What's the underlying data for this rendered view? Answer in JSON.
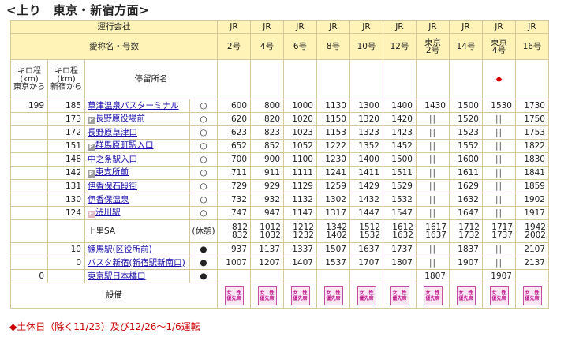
{
  "title": "<上り　東京・新宿方面>",
  "header": {
    "operator_label": "運行会社",
    "name_label": "愛称名・号数",
    "km_tokyo": [
      "キロ程",
      "(km)",
      "東京から"
    ],
    "km_shinjuku": [
      "キロ程",
      "(km)",
      "新宿から"
    ],
    "stop_label": "停留所名",
    "operators": [
      "JR",
      "JR",
      "JR",
      "JR",
      "JR",
      "JR",
      "JR",
      "JR",
      "JR",
      "JR"
    ],
    "names": [
      [
        "2号"
      ],
      [
        "4号"
      ],
      [
        "6号"
      ],
      [
        "8号"
      ],
      [
        "10号"
      ],
      [
        "12号"
      ],
      [
        "東京",
        "2号"
      ],
      [
        "14号"
      ],
      [
        "東京",
        "4号"
      ],
      [
        "16号"
      ]
    ],
    "diamond_col": 8,
    "diamond_text": "◆"
  },
  "rows": [
    {
      "kt": "199",
      "ks": "185",
      "name": "草津温泉バスターミナル",
      "icon": "",
      "mark": "○",
      "times": [
        "600",
        "800",
        "1000",
        "1130",
        "1300",
        "1400",
        "1430",
        "1500",
        "1530",
        "1730"
      ]
    },
    {
      "kt": "",
      "ks": "173",
      "name": "長野原役場前",
      "icon": "P",
      "mark": "○",
      "times": [
        "620",
        "820",
        "1020",
        "1150",
        "1320",
        "1420",
        "||",
        "1520",
        "||",
        "1750"
      ]
    },
    {
      "kt": "",
      "ks": "172",
      "name": "長野原草津口",
      "icon": "",
      "mark": "○",
      "times": [
        "623",
        "823",
        "1023",
        "1153",
        "1323",
        "1423",
        "||",
        "1523",
        "||",
        "1753"
      ]
    },
    {
      "kt": "",
      "ks": "151",
      "name": "群馬原町駅入口",
      "icon": "P",
      "mark": "○",
      "times": [
        "652",
        "852",
        "1052",
        "1222",
        "1352",
        "1452",
        "||",
        "1552",
        "||",
        "1822"
      ]
    },
    {
      "kt": "",
      "ks": "148",
      "name": "中之条駅入口",
      "icon": "",
      "mark": "○",
      "times": [
        "700",
        "900",
        "1100",
        "1230",
        "1400",
        "1500",
        "||",
        "1600",
        "||",
        "1830"
      ]
    },
    {
      "kt": "",
      "ks": "142",
      "name": "東支所前",
      "icon": "P",
      "mark": "○",
      "times": [
        "711",
        "911",
        "1111",
        "1241",
        "1411",
        "1511",
        "||",
        "1611",
        "||",
        "1841"
      ]
    },
    {
      "kt": "",
      "ks": "131",
      "name": "伊香保石段街",
      "icon": "",
      "mark": "○",
      "times": [
        "729",
        "929",
        "1129",
        "1259",
        "1429",
        "1529",
        "||",
        "1629",
        "||",
        "1859"
      ]
    },
    {
      "kt": "",
      "ks": "130",
      "name": "伊香保温泉",
      "icon": "",
      "mark": "○",
      "times": [
        "732",
        "932",
        "1132",
        "1302",
        "1432",
        "1532",
        "||",
        "1632",
        "||",
        "1902"
      ]
    },
    {
      "kt": "",
      "ks": "124",
      "name": "渋川駅",
      "icon": "P2",
      "mark": "○",
      "times": [
        "747",
        "947",
        "1147",
        "1317",
        "1447",
        "1547",
        "||",
        "1647",
        "||",
        "1917"
      ]
    }
  ],
  "sa": {
    "name": "上里SA",
    "note": "(休憩)",
    "times": [
      [
        "812",
        "832"
      ],
      [
        "1012",
        "1032"
      ],
      [
        "1212",
        "1232"
      ],
      [
        "1342",
        "1402"
      ],
      [
        "1512",
        "1532"
      ],
      [
        "1612",
        "1632"
      ],
      [
        "1617",
        "1637"
      ],
      [
        "1712",
        "1732"
      ],
      [
        "1717",
        "1737"
      ],
      [
        "1942",
        "2002"
      ]
    ]
  },
  "rows2": [
    {
      "kt": "",
      "ks": "10",
      "name": "練馬駅(区役所前)",
      "mark": "●",
      "times": [
        "937",
        "1137",
        "1337",
        "1507",
        "1637",
        "1737",
        "||",
        "1837",
        "||",
        "2107"
      ]
    },
    {
      "kt": "",
      "ks": "0",
      "name": "バスタ新宿(新宿駅新南口)",
      "mark": "●",
      "times": [
        "1007",
        "1207",
        "1407",
        "1537",
        "1707",
        "1807",
        "||",
        "1907",
        "||",
        "2137"
      ]
    },
    {
      "kt": "0",
      "ks": "",
      "name": "東京駅日本橋口",
      "mark": "●",
      "times": [
        "",
        "",
        "",
        "",
        "",
        "",
        "1807",
        "",
        "1907",
        ""
      ]
    }
  ],
  "equipment_label": "設備",
  "badge": {
    "line1": "女　性",
    "line2": "優先席"
  },
  "footnote": "◆土休日（除く11/23）及び12/26～1/6運転"
}
